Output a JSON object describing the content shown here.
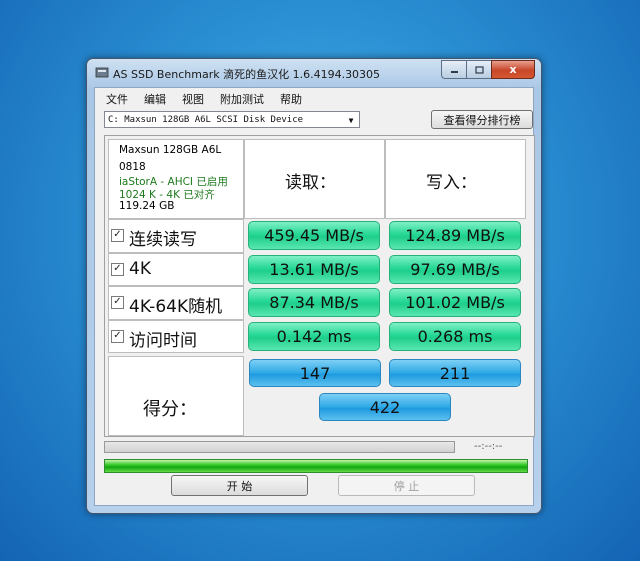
{
  "window": {
    "title": "AS SSD Benchmark 滴死的鱼汉化 1.6.4194.30305",
    "caption": {
      "close": "x"
    }
  },
  "menu": [
    "文件",
    "编辑",
    "视图",
    "附加测试",
    "帮助"
  ],
  "drive": {
    "selected": "C: Maxsun 128GB A6L SCSI Disk Device",
    "ranking_button": "查看得分排行榜"
  },
  "info": {
    "model": "Maxsun 128GB A6L",
    "firmware": "0818",
    "driver": "iaStorA - AHCI 已启用",
    "alignment": "1024 K - 4K 已对齐",
    "capacity": "119.24 GB"
  },
  "headers": {
    "read": "读取：",
    "write": "写入："
  },
  "rows": [
    {
      "label": "连续读写",
      "checked": true,
      "read": "459.45 MB/s",
      "write": "124.89 MB/s"
    },
    {
      "label": "4K",
      "checked": true,
      "read": "13.61 MB/s",
      "write": "97.69 MB/s"
    },
    {
      "label": "4K-64K随机",
      "checked": true,
      "read": "87.34 MB/s",
      "write": "101.02 MB/s"
    },
    {
      "label": "访问时间",
      "checked": true,
      "read": "0.142 ms",
      "write": "0.268 ms"
    }
  ],
  "score": {
    "label": "得分：",
    "read": "147",
    "write": "211",
    "total": "422"
  },
  "progress": {
    "elapsed": "--:--:--",
    "fraction": 1.0
  },
  "buttons": {
    "start": "开  始",
    "stop": "停  止"
  },
  "colors": {
    "result_green": "#26d895",
    "score_blue": "#2ea8e6",
    "info_green": "#1d7a1d",
    "close_red": "#c7472a"
  }
}
